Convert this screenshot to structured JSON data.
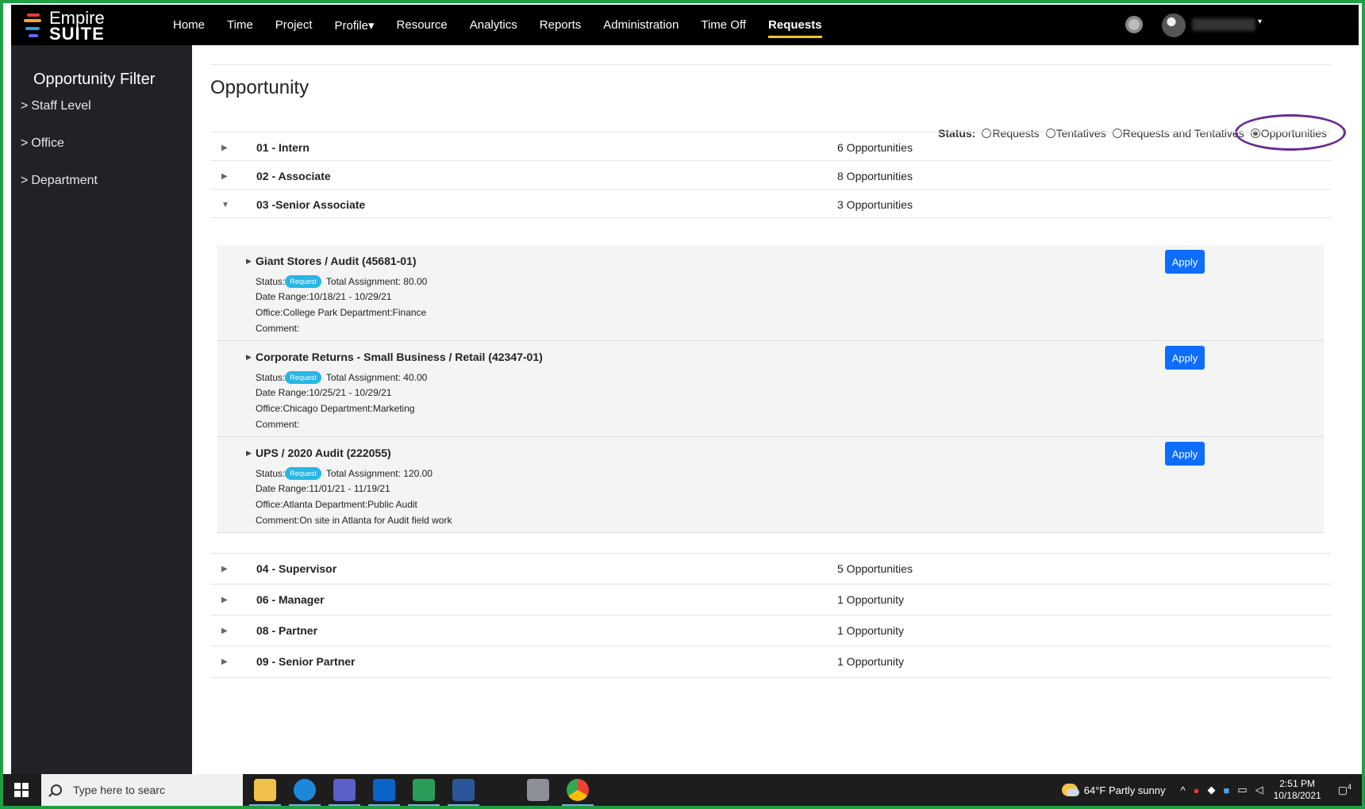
{
  "brand": {
    "line1": "Empire",
    "line2": "SUITE"
  },
  "nav": {
    "items": [
      "Home",
      "Time",
      "Project",
      "Profile▾",
      "Resource",
      "Analytics",
      "Reports",
      "Administration",
      "Time Off",
      "Requests"
    ],
    "active": "Requests"
  },
  "sidebar": {
    "title": "Opportunity Filter",
    "items": [
      "Staff Level",
      "Office",
      "Department"
    ]
  },
  "main": {
    "title": "Opportunity",
    "status": {
      "label": "Status:",
      "options": [
        "Requests",
        "Tentatives",
        "Requests and Tentatives",
        "Opportunities"
      ],
      "selected": "Opportunities"
    },
    "groups": [
      {
        "name": "01 - Intern",
        "count": "6 Opportunities"
      },
      {
        "name": "02 - Associate",
        "count": "8 Opportunities"
      },
      {
        "name": "03 -Senior Associate",
        "count": "3 Opportunities"
      },
      {
        "name": "04 - Supervisor",
        "count": "5 Opportunities"
      },
      {
        "name": "06 - Manager",
        "count": "1 Opportunity"
      },
      {
        "name": "08 - Partner",
        "count": "1 Opportunity"
      },
      {
        "name": "09 - Senior Partner",
        "count": "1 Opportunity"
      }
    ],
    "opportunities": [
      {
        "title": "Giant Stores / Audit (45681-01)",
        "status_label": "Status:",
        "status_badge": "Request",
        "assignment": "Total Assignment: 80.00",
        "date_range": "Date Range:10/18/21 - 10/29/21",
        "office": "Office:College Park Department:Finance",
        "comment": "Comment:"
      },
      {
        "title": "Corporate Returns - Small Business / Retail (42347-01)",
        "status_label": "Status:",
        "status_badge": "Request",
        "assignment": "Total Assignment: 40.00",
        "date_range": "Date Range:10/25/21 - 10/29/21",
        "office": "Office:Chicago Department:Marketing",
        "comment": "Comment:"
      },
      {
        "title": "UPS / 2020 Audit (222055)",
        "status_label": "Status:",
        "status_badge": "Request",
        "assignment": "Total Assignment: 120.00",
        "date_range": "Date Range:11/01/21 - 11/19/21",
        "office": "Office:Atlanta Department:Public Audit",
        "comment": "Comment:On site in Atlanta for Audit field work"
      }
    ],
    "apply_label": "Apply"
  },
  "taskbar": {
    "search_placeholder": "Type here to searc",
    "weather": "64°F  Partly sunny",
    "time": "2:51 PM",
    "date": "10/18/2021",
    "notification_count": "4"
  },
  "colors": {
    "nav_bg": "#000000",
    "sidebar_bg": "#202228",
    "accent_underline": "#f2c230",
    "apply_button": "#0d6efd",
    "status_badge": "#29b5e8",
    "highlight_ring": "#6a2c91",
    "frame": "#1fa045"
  }
}
